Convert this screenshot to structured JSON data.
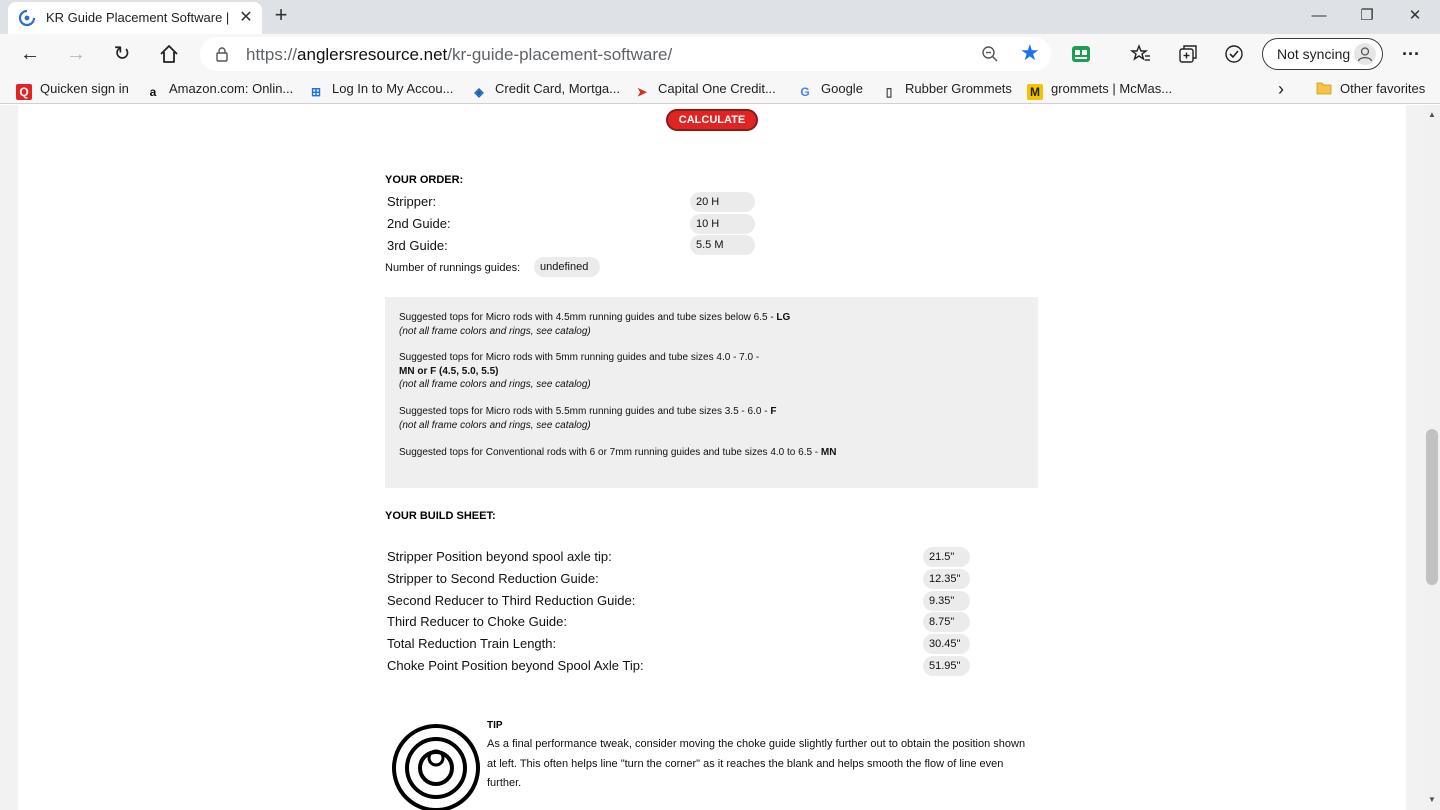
{
  "browser": {
    "tab_title": "KR Guide Placement Software | A",
    "url_prefix": "https://",
    "url_host": "anglersresource.net",
    "url_path": "/kr-guide-placement-software/",
    "sync_label": "Not syncing",
    "new_tab": "+",
    "tab_close": "✕",
    "minimize": "—",
    "restore": "❐",
    "close": "✕",
    "more": "···"
  },
  "bookmarks": {
    "items": [
      {
        "label": "Quicken sign in",
        "icon": "quicken-icon",
        "glyph": "Q",
        "color": "#e02424"
      },
      {
        "label": "Amazon.com: Onlin...",
        "icon": "amazon-icon",
        "glyph": "a",
        "color": "#111111"
      },
      {
        "label": "Log In to My Accou...",
        "icon": "account-icon",
        "glyph": "⊞",
        "color": "#1a73e8"
      },
      {
        "label": "Credit Card, Mortga...",
        "icon": "chase-icon",
        "glyph": "◈",
        "color": "#1a5fb4"
      },
      {
        "label": "Capital One Credit...",
        "icon": "capital-one-icon",
        "glyph": "➤",
        "color": "#d22e1e"
      },
      {
        "label": "Google",
        "icon": "google-icon",
        "glyph": "G",
        "color": "#4285f4"
      },
      {
        "label": "Rubber Grommets",
        "icon": "page-icon",
        "glyph": "▯",
        "color": "#444444"
      },
      {
        "label": "grommets | McMas...",
        "icon": "mcmaster-icon",
        "glyph": "M",
        "color": "#222222"
      }
    ],
    "overflow": "›",
    "other_favorites": "Other favorites"
  },
  "page": {
    "calculate_label": "CALCULATE",
    "order": {
      "title": "YOUR ORDER:",
      "rows": [
        {
          "label": "Stripper:",
          "value": "20 H"
        },
        {
          "label": "2nd Guide:",
          "value": "10 H"
        },
        {
          "label": "3rd Guide:",
          "value": "5.5 M"
        }
      ],
      "running_label": "Number of runnings guides:",
      "running_value": "undefined"
    },
    "suggestions": {
      "s1_text": "Suggested tops for Micro rods with 4.5mm running guides and tube sizes below 6.5 - ",
      "s1_bold": "LG",
      "s1_note": "(not all frame colors and rings, see catalog)",
      "s2_text": "Suggested tops for Micro rods with 5mm running guides and tube sizes 4.0 - 7.0 -",
      "s2_bold": "MN or F (4.5, 5.0, 5.5)",
      "s2_note": "(not all frame colors and rings, see catalog)",
      "s3_text": "Suggested tops for Micro rods with 5.5mm running guides and tube sizes 3.5 - 6.0 - ",
      "s3_bold": "F",
      "s3_note": "(not all frame colors and rings, see catalog)",
      "s4_text": "Suggested tops for Conventional rods with 6 or 7mm running guides and tube sizes 4.0 to 6.5 - ",
      "s4_bold": "MN"
    },
    "build": {
      "title": "YOUR BUILD SHEET:",
      "rows": [
        {
          "label": "Stripper Position beyond spool axle tip:",
          "value": "21.5\""
        },
        {
          "label": "Stripper to Second Reduction Guide:",
          "value": "12.35\""
        },
        {
          "label": "Second Reducer to Third Reduction Guide:",
          "value": "9.35\""
        },
        {
          "label": "Third Reducer to Choke Guide:",
          "value": "8.75\""
        },
        {
          "label": "Total Reduction Train Length:",
          "value": "30.45\""
        },
        {
          "label": "Choke Point Position beyond Spool Axle Tip:",
          "value": "51.95\""
        }
      ]
    },
    "tip": {
      "title": "TIP",
      "body": "As a final performance tweak, consider moving the choke guide slightly further out to obtain the position shown at left. This often helps line \"turn the corner\" as it reaches the blank and helps smooth the flow of line even further."
    }
  }
}
